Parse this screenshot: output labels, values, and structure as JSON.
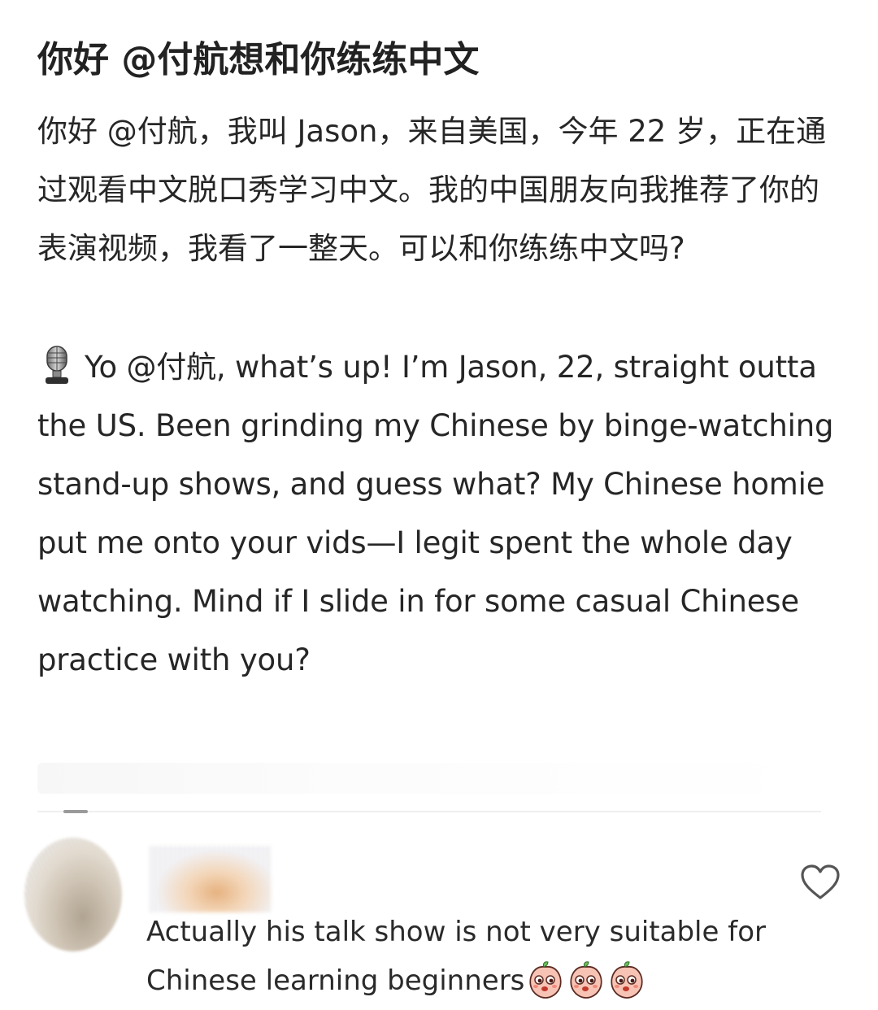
{
  "post": {
    "title": "你好 @付航想和你练练中文",
    "body_cn": "你好 @付航，我叫 Jason，来自美国，今年 22 岁，正在通过观看中文脱口秀学习中文。我的中国朋友向我推荐了你的表演视频，我看了一整天。可以和你练练中文吗?",
    "body_en": "Yo @付航, what’s up! I’m Jason, 22, straight outta the US. Been grinding my Chinese by binge-watching stand-up shows, and guess what? My Chinese homie put me onto your vids—I legit spent the whole day watching. Mind if I slide in for some casual Chinese practice with you?",
    "mic_icon": "microphone-icon"
  },
  "comment": {
    "text": "Actually his talk show is not very suitable for Chinese learning beginners",
    "emoji_icon": "peach-face-emoji",
    "emoji_count": 3,
    "like_icon": "heart-outline-icon"
  },
  "colors": {
    "text": "#262626",
    "divider": "#efefef",
    "heart_stroke": "#555555"
  }
}
